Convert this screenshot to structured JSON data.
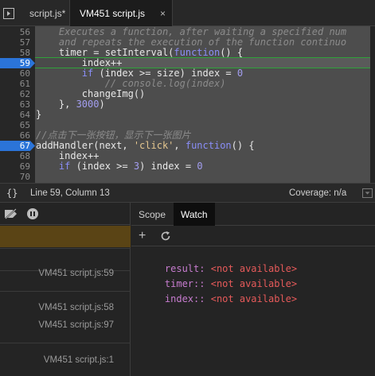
{
  "tabs": [
    {
      "label": "script.js*"
    },
    {
      "label": "VM451 script.js",
      "close": "×"
    }
  ],
  "editor": {
    "lines": [
      {
        "n": "56",
        "html": "<span class=\"c-cmt\">    Executes a function, after waiting a specified num</span>"
      },
      {
        "n": "57",
        "html": "<span class=\"c-cmt\">    and repeats the execution of the function continuo</span>"
      },
      {
        "n": "58",
        "html": "    timer = setInterval(<span class=\"c-kw\">function</span>() {"
      },
      {
        "n": "59",
        "html": "        index++"
      },
      {
        "n": "60",
        "html": "        <span class=\"c-kw\">if</span> (index &gt;= size) index = <span class=\"c-num\">0</span>"
      },
      {
        "n": "61",
        "html": "<span class=\"c-cmt\">            // console.log(index)</span>"
      },
      {
        "n": "62",
        "html": "        changeImg()"
      },
      {
        "n": "63",
        "html": "    }, <span class=\"c-num\">3000</span>)"
      },
      {
        "n": "64",
        "html": "}"
      },
      {
        "n": "65",
        "html": ""
      },
      {
        "n": "66",
        "html": "<span class=\"c-cmt\">//点击下一张按钮，显示下一张图片</span>"
      },
      {
        "n": "67",
        "html": "addHandler(next, <span class=\"c-str\">'click'</span>, <span class=\"c-kw\">function</span>() {"
      },
      {
        "n": "68",
        "html": "    index++"
      },
      {
        "n": "69",
        "html": "    <span class=\"c-kw\">if</span> (index &gt;= <span class=\"c-num\">3</span>) index = <span class=\"c-num\">0</span>"
      },
      {
        "n": "70",
        "html": ""
      }
    ],
    "current_line": "59",
    "breakpoint_line": "67"
  },
  "status": {
    "braces": "{}",
    "position": "Line 59, Column 13",
    "coverage": "Coverage: n/a"
  },
  "callstack": {
    "frames": [
      "VM451 script.js:59",
      "VM451 script.js:58",
      "VM451 script.js:97",
      "VM451 script.js:1"
    ]
  },
  "sidebar_tabs": {
    "scope": "Scope",
    "watch": "Watch"
  },
  "watch": {
    "add": "+",
    "items": [
      {
        "name": "result:",
        "value": "<not available>"
      },
      {
        "name": "timer::",
        "value": "<not available>"
      },
      {
        "name": "index::",
        "value": "<not available>"
      }
    ]
  },
  "colors": {
    "accent_blue": "#2b74d8",
    "exec_green": "#2fa33a",
    "paused_bg": "#5a4415",
    "watch_name": "#c77ccf",
    "watch_value": "#e65a5a"
  }
}
